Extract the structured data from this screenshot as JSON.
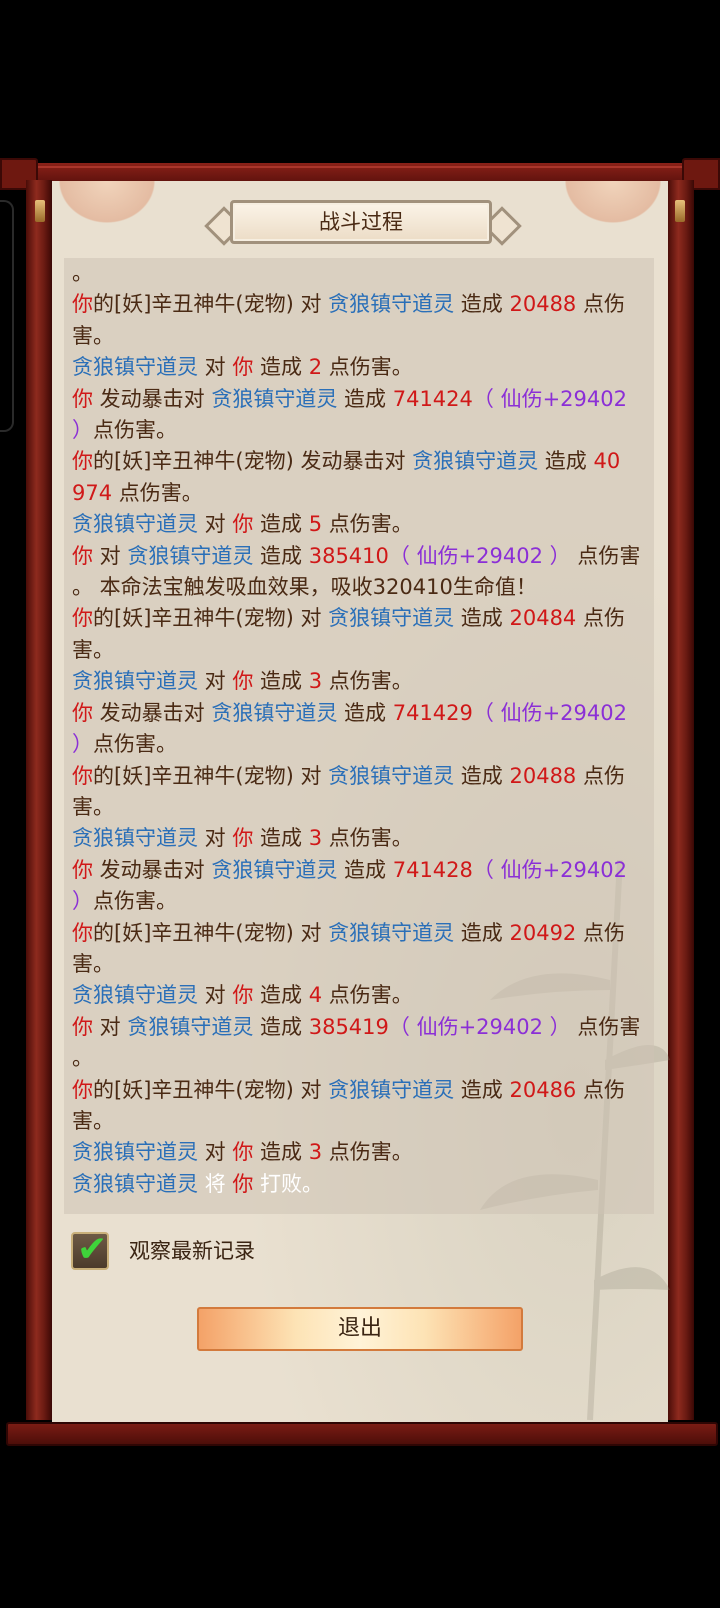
{
  "window": {
    "title": "战斗过程"
  },
  "log": {
    "lines": [
      [
        {
          "t": "。",
          "c": "b"
        }
      ],
      [
        {
          "t": "你",
          "c": "y"
        },
        {
          "t": "的[妖]辛丑神牛(宠物) 对 ",
          "c": "b"
        },
        {
          "t": "贪狼镇守道灵",
          "c": "e"
        },
        {
          "t": " 造成 ",
          "c": "b"
        },
        {
          "t": "20488",
          "c": "n"
        },
        {
          "t": " 点伤",
          "c": "b"
        }
      ],
      [
        {
          "t": "害。",
          "c": "b"
        }
      ],
      [
        {
          "t": "贪狼镇守道灵",
          "c": "e"
        },
        {
          "t": " 对 ",
          "c": "b"
        },
        {
          "t": "你",
          "c": "y"
        },
        {
          "t": " 造成 ",
          "c": "b"
        },
        {
          "t": "2",
          "c": "n"
        },
        {
          "t": " 点伤害。",
          "c": "b"
        }
      ],
      [
        {
          "t": "你",
          "c": "y"
        },
        {
          "t": " 发动暴击对 ",
          "c": "b"
        },
        {
          "t": "贪狼镇守道灵",
          "c": "e"
        },
        {
          "t": " 造成 ",
          "c": "b"
        },
        {
          "t": "741424",
          "c": "n"
        },
        {
          "t": "（ 仙伤+29402",
          "c": "v"
        }
      ],
      [
        {
          "t": "）",
          "c": "v"
        },
        {
          "t": "点伤害。",
          "c": "b"
        }
      ],
      [
        {
          "t": "你",
          "c": "y"
        },
        {
          "t": "的[妖]辛丑神牛(宠物) 发动暴击对 ",
          "c": "b"
        },
        {
          "t": "贪狼镇守道灵",
          "c": "e"
        },
        {
          "t": " 造成 ",
          "c": "b"
        },
        {
          "t": "40",
          "c": "n"
        }
      ],
      [
        {
          "t": "974",
          "c": "n"
        },
        {
          "t": " 点伤害。",
          "c": "b"
        }
      ],
      [
        {
          "t": "贪狼镇守道灵",
          "c": "e"
        },
        {
          "t": " 对 ",
          "c": "b"
        },
        {
          "t": "你",
          "c": "y"
        },
        {
          "t": " 造成 ",
          "c": "b"
        },
        {
          "t": "5",
          "c": "n"
        },
        {
          "t": " 点伤害。",
          "c": "b"
        }
      ],
      [
        {
          "t": "你",
          "c": "y"
        },
        {
          "t": " 对 ",
          "c": "b"
        },
        {
          "t": "贪狼镇守道灵",
          "c": "e"
        },
        {
          "t": " 造成 ",
          "c": "b"
        },
        {
          "t": "385410",
          "c": "n"
        },
        {
          "t": "（ 仙伤+29402 ）",
          "c": "v"
        },
        {
          "t": " 点伤害",
          "c": "b"
        }
      ],
      [
        {
          "t": "。 本命法宝触发吸血效果，吸收320410生命值！",
          "c": "b"
        }
      ],
      [
        {
          "t": "你",
          "c": "y"
        },
        {
          "t": "的[妖]辛丑神牛(宠物) 对 ",
          "c": "b"
        },
        {
          "t": "贪狼镇守道灵",
          "c": "e"
        },
        {
          "t": " 造成 ",
          "c": "b"
        },
        {
          "t": "20484",
          "c": "n"
        },
        {
          "t": " 点伤",
          "c": "b"
        }
      ],
      [
        {
          "t": "害。",
          "c": "b"
        }
      ],
      [
        {
          "t": "贪狼镇守道灵",
          "c": "e"
        },
        {
          "t": " 对 ",
          "c": "b"
        },
        {
          "t": "你",
          "c": "y"
        },
        {
          "t": " 造成 ",
          "c": "b"
        },
        {
          "t": "3",
          "c": "n"
        },
        {
          "t": " 点伤害。",
          "c": "b"
        }
      ],
      [
        {
          "t": "你",
          "c": "y"
        },
        {
          "t": " 发动暴击对 ",
          "c": "b"
        },
        {
          "t": "贪狼镇守道灵",
          "c": "e"
        },
        {
          "t": " 造成 ",
          "c": "b"
        },
        {
          "t": "741429",
          "c": "n"
        },
        {
          "t": "（ 仙伤+29402",
          "c": "v"
        }
      ],
      [
        {
          "t": "）",
          "c": "v"
        },
        {
          "t": "点伤害。",
          "c": "b"
        }
      ],
      [
        {
          "t": "你",
          "c": "y"
        },
        {
          "t": "的[妖]辛丑神牛(宠物) 对 ",
          "c": "b"
        },
        {
          "t": "贪狼镇守道灵",
          "c": "e"
        },
        {
          "t": " 造成 ",
          "c": "b"
        },
        {
          "t": "20488",
          "c": "n"
        },
        {
          "t": " 点伤",
          "c": "b"
        }
      ],
      [
        {
          "t": "害。",
          "c": "b"
        }
      ],
      [
        {
          "t": "贪狼镇守道灵",
          "c": "e"
        },
        {
          "t": " 对 ",
          "c": "b"
        },
        {
          "t": "你",
          "c": "y"
        },
        {
          "t": " 造成 ",
          "c": "b"
        },
        {
          "t": "3",
          "c": "n"
        },
        {
          "t": " 点伤害。",
          "c": "b"
        }
      ],
      [
        {
          "t": "你",
          "c": "y"
        },
        {
          "t": " 发动暴击对 ",
          "c": "b"
        },
        {
          "t": "贪狼镇守道灵",
          "c": "e"
        },
        {
          "t": " 造成 ",
          "c": "b"
        },
        {
          "t": "741428",
          "c": "n"
        },
        {
          "t": "（ 仙伤+29402",
          "c": "v"
        }
      ],
      [
        {
          "t": "）",
          "c": "v"
        },
        {
          "t": "点伤害。",
          "c": "b"
        }
      ],
      [
        {
          "t": "你",
          "c": "y"
        },
        {
          "t": "的[妖]辛丑神牛(宠物) 对 ",
          "c": "b"
        },
        {
          "t": "贪狼镇守道灵",
          "c": "e"
        },
        {
          "t": " 造成 ",
          "c": "b"
        },
        {
          "t": "20492",
          "c": "n"
        },
        {
          "t": " 点伤",
          "c": "b"
        }
      ],
      [
        {
          "t": "害。",
          "c": "b"
        }
      ],
      [
        {
          "t": "贪狼镇守道灵",
          "c": "e"
        },
        {
          "t": " 对 ",
          "c": "b"
        },
        {
          "t": "你",
          "c": "y"
        },
        {
          "t": " 造成 ",
          "c": "b"
        },
        {
          "t": "4",
          "c": "n"
        },
        {
          "t": " 点伤害。",
          "c": "b"
        }
      ],
      [
        {
          "t": "你",
          "c": "y"
        },
        {
          "t": " 对 ",
          "c": "b"
        },
        {
          "t": "贪狼镇守道灵",
          "c": "e"
        },
        {
          "t": " 造成 ",
          "c": "b"
        },
        {
          "t": "385419",
          "c": "n"
        },
        {
          "t": "（ 仙伤+29402 ）",
          "c": "v"
        },
        {
          "t": " 点伤害",
          "c": "b"
        }
      ],
      [
        {
          "t": "。",
          "c": "b"
        }
      ],
      [
        {
          "t": "你",
          "c": "y"
        },
        {
          "t": "的[妖]辛丑神牛(宠物) 对 ",
          "c": "b"
        },
        {
          "t": "贪狼镇守道灵",
          "c": "e"
        },
        {
          "t": " 造成 ",
          "c": "b"
        },
        {
          "t": "20486",
          "c": "n"
        },
        {
          "t": " 点伤",
          "c": "b"
        }
      ],
      [
        {
          "t": "害。",
          "c": "b"
        }
      ],
      [
        {
          "t": "贪狼镇守道灵",
          "c": "e"
        },
        {
          "t": " 对 ",
          "c": "b"
        },
        {
          "t": "你",
          "c": "y"
        },
        {
          "t": " 造成 ",
          "c": "b"
        },
        {
          "t": "3",
          "c": "n"
        },
        {
          "t": " 点伤害。",
          "c": "b"
        }
      ],
      [
        {
          "t": "贪狼镇守道灵",
          "c": "e"
        },
        {
          "t": " 将 ",
          "c": "w"
        },
        {
          "t": "你",
          "c": "y"
        },
        {
          "t": " 打败。",
          "c": "w"
        }
      ]
    ]
  },
  "checkbox": {
    "label": "观察最新记录",
    "checked": true,
    "icon": "check-icon"
  },
  "exit_button": {
    "label": "退出"
  },
  "colors": {
    "you": "#d01818",
    "enemy": "#2a6fb8",
    "number": "#d01818",
    "immortal_damage": "#8b2fd6",
    "text": "#4a2a14",
    "frame": "#7a1c14"
  }
}
